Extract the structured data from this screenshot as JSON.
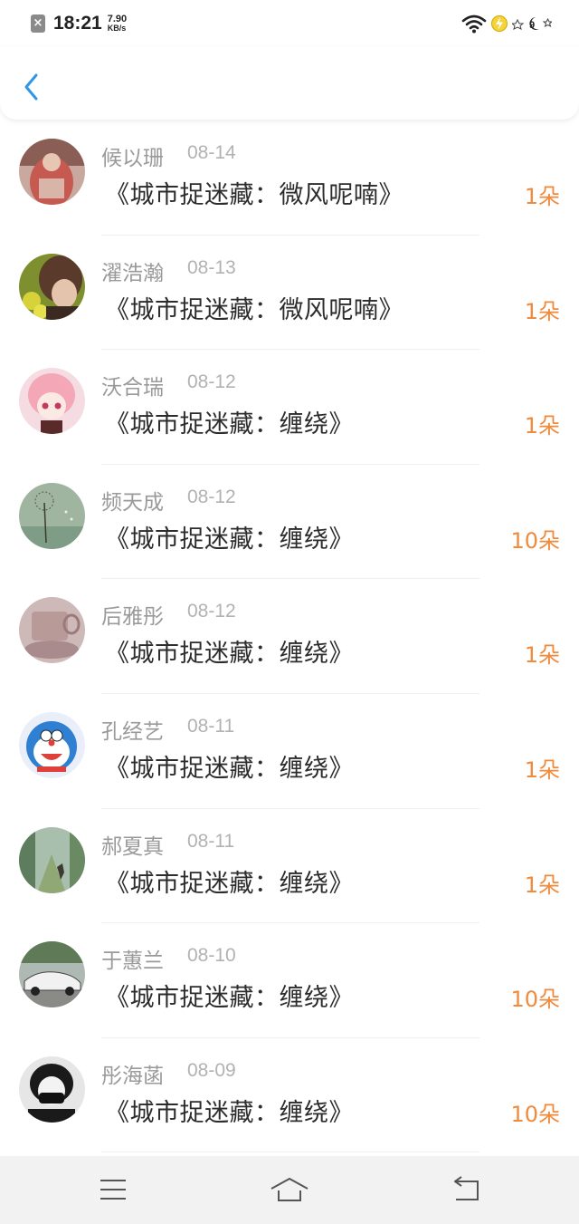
{
  "status_bar": {
    "time": "18:21",
    "net_speed_value": "7.90",
    "net_speed_unit": "KB/s",
    "icons": [
      "notification-x-icon",
      "wifi-icon",
      "charging-icon",
      "weather-icon"
    ]
  },
  "header": {
    "back_icon": "chevron-left-icon"
  },
  "colors": {
    "accent_blue": "#2f96e8",
    "amount_orange": "#f08a3c",
    "name_gray": "#9a9a9a",
    "title_dark": "#2c2c2c"
  },
  "gifts": [
    {
      "name": "候以珊",
      "date": "08-14",
      "title": "《城市捉迷藏：微风呢喃》",
      "amount": "1朵"
    },
    {
      "name": "濯浩瀚",
      "date": "08-13",
      "title": "《城市捉迷藏：微风呢喃》",
      "amount": "1朵"
    },
    {
      "name": "沃合瑞",
      "date": "08-12",
      "title": "《城市捉迷藏：缠绕》",
      "amount": "1朵"
    },
    {
      "name": "频天成",
      "date": "08-12",
      "title": "《城市捉迷藏：缠绕》",
      "amount": "10朵"
    },
    {
      "name": "后雅彤",
      "date": "08-12",
      "title": "《城市捉迷藏：缠绕》",
      "amount": "1朵"
    },
    {
      "name": "孔经艺",
      "date": "08-11",
      "title": "《城市捉迷藏：缠绕》",
      "amount": "1朵"
    },
    {
      "name": "郝夏真",
      "date": "08-11",
      "title": "《城市捉迷藏：缠绕》",
      "amount": "1朵"
    },
    {
      "name": "于蕙兰",
      "date": "08-10",
      "title": "《城市捉迷藏：缠绕》",
      "amount": "10朵"
    },
    {
      "name": "彤海菡",
      "date": "08-09",
      "title": "《城市捉迷藏：缠绕》",
      "amount": "10朵"
    }
  ],
  "nav_bar": {
    "buttons": [
      "menu-icon",
      "home-icon",
      "back-icon"
    ]
  }
}
